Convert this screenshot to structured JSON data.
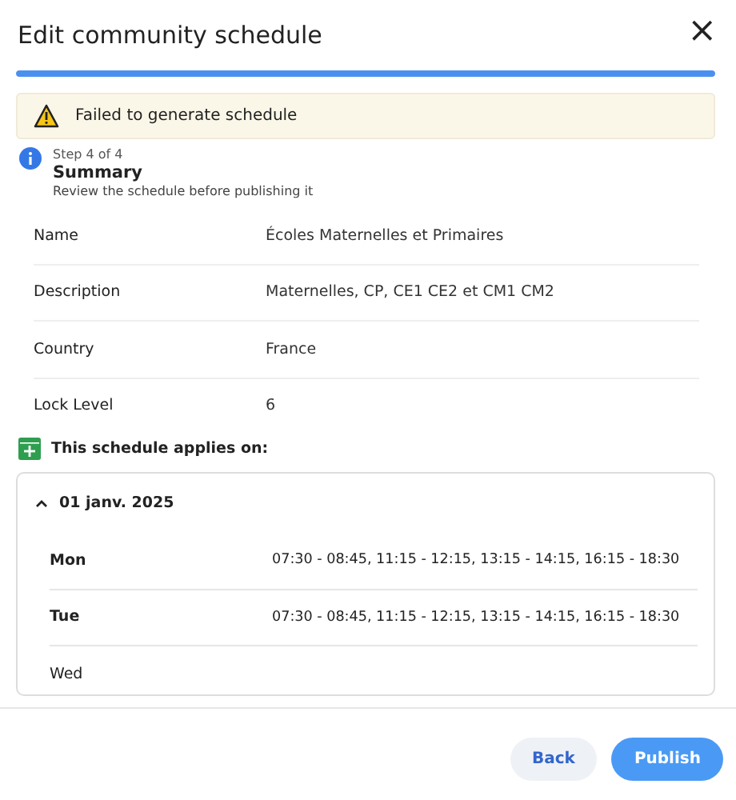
{
  "dialog": {
    "title": "Edit community schedule",
    "close": "×"
  },
  "progress": {
    "level": 1
  },
  "alert": {
    "message": "Failed to generate schedule"
  },
  "step": {
    "counter": "Step 4 of 4",
    "title": "Summary",
    "description": "Review the schedule before publishing it"
  },
  "details": [
    {
      "label": "Name",
      "value": "Écoles Maternelles et Primaires"
    },
    {
      "label": "Description",
      "value": "Maternelles, CP, CE1 CE2 et CM1 CM2"
    },
    {
      "label": "Country",
      "value": "France"
    },
    {
      "label": "Lock Level",
      "value": "6"
    }
  ],
  "applies_on": {
    "heading": "This schedule applies on:"
  },
  "periods": [
    {
      "date": "01 janv. 2025",
      "expanded": true,
      "days": [
        {
          "day": "Mon",
          "open": true,
          "hours": "07:30 - 08:45, 11:15 - 12:15, 13:15 - 14:15, 16:15 - 18:30"
        },
        {
          "day": "Tue",
          "open": true,
          "hours": "07:30 - 08:45, 11:15 - 12:15, 13:15 - 14:15, 16:15 - 18:30"
        },
        {
          "day": "Wed",
          "open": false
        }
      ]
    }
  ],
  "buttons": [
    {
      "label": "Back",
      "kind": "secondary"
    },
    {
      "label": "Publish",
      "kind": "primary"
    }
  ]
}
